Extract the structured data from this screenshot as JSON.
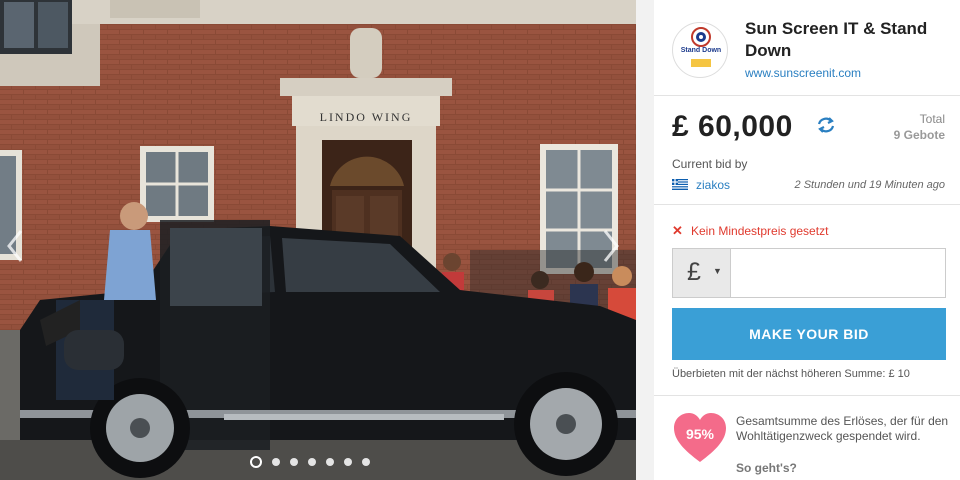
{
  "gallery": {
    "building_sign": "LINDO WING",
    "slide_count": 7,
    "active_slide": 1
  },
  "seller": {
    "logo_text": "Stand Down",
    "name": "Sun Screen IT & Stand Down",
    "url": "www.sunscreenit.com"
  },
  "auction": {
    "price": "£ 60,000",
    "total_label": "Total",
    "total_count": "9 Gebote",
    "current_bid_label": "Current bid by",
    "bidder": "ziakos",
    "bid_time": "2 Stunden und 19 Minuten ago",
    "reserve_icon": "✕",
    "reserve_text": "Kein Mindestpreis gesetzt",
    "currency_symbol": "£",
    "currency_caret": "▼",
    "bid_placeholder": "",
    "bid_button": "MAKE YOUR BID",
    "increment_text": "Überbieten mit der nächst höheren Summe: £ 10"
  },
  "charity": {
    "percent": "95%",
    "description": "Gesamtsumme des Erlöses, der für den Wohltätigenzweck gespendet wird.",
    "how_link": "So geht's?"
  },
  "colors": {
    "accent": "#3a9fd6",
    "link": "#2a7fc1",
    "warning": "#e03a2e",
    "heart": "#f46b8a"
  },
  "icons": {
    "refresh": "refresh-icon",
    "flag": "greece-flag-icon",
    "reserve": "close-icon",
    "heart": "heart-icon",
    "arrow_left": "chevron-left-icon",
    "arrow_right": "chevron-right-icon"
  }
}
